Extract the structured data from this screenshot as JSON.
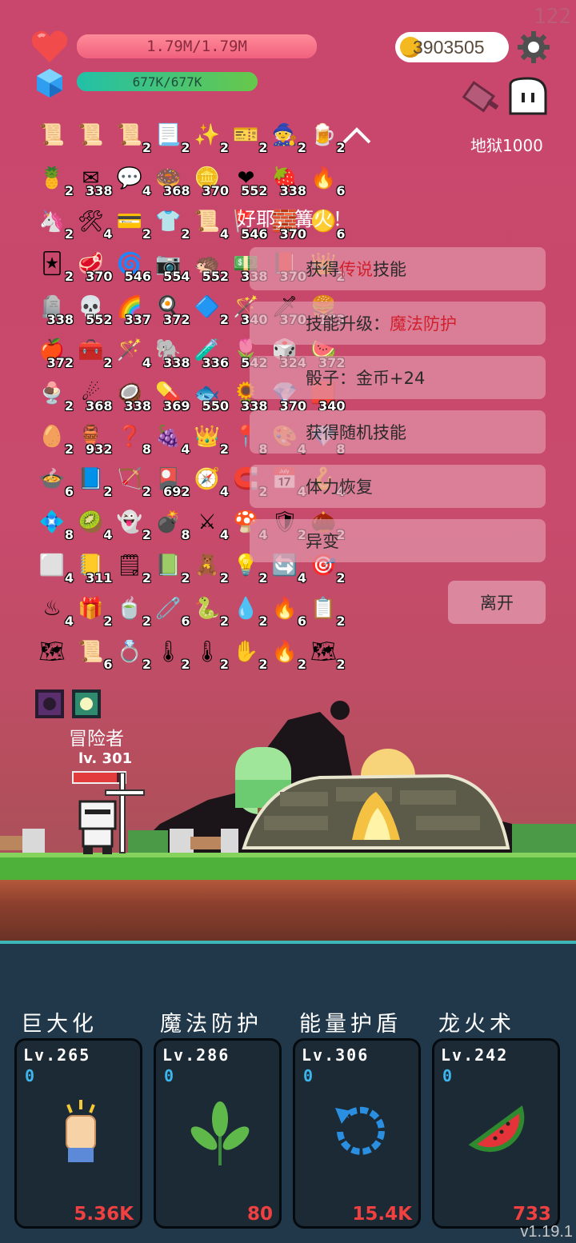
{
  "status": {
    "top_counter": "122",
    "hp_text": "1.79M/1.79M",
    "hp_fraction": 1.0,
    "mp_text": "677K/677K",
    "mp_fraction": 1.0,
    "gold": "3903505",
    "stage_label": "地狱1000"
  },
  "inventory": {
    "rows": [
      [
        {
          "i": "📜",
          "c": ""
        },
        {
          "i": "📜",
          "c": ""
        },
        {
          "i": "📜",
          "c": "2"
        },
        {
          "i": "📃",
          "c": "2"
        },
        {
          "i": "✨",
          "c": "2"
        },
        {
          "i": "🎫",
          "c": "2"
        },
        {
          "i": "🧙",
          "c": "2"
        },
        {
          "i": "🍺",
          "c": "2"
        }
      ],
      [
        {
          "i": "🍍",
          "c": "2"
        },
        {
          "i": "✉",
          "c": "338"
        },
        {
          "i": "💬",
          "c": "4"
        },
        {
          "i": "🍩",
          "c": "368"
        },
        {
          "i": "🪙",
          "c": "370"
        },
        {
          "i": "❤",
          "c": "552"
        },
        {
          "i": "🍓",
          "c": "338"
        },
        {
          "i": "🔥",
          "c": "6"
        }
      ],
      [
        {
          "i": "🦄",
          "c": "2"
        },
        {
          "i": "🛠",
          "c": "4"
        },
        {
          "i": "💳",
          "c": "2"
        },
        {
          "i": "👕",
          "c": "2"
        },
        {
          "i": "📜",
          "c": "4"
        },
        {
          "i": "🚩",
          "c": "546"
        },
        {
          "i": "🧱",
          "c": "370"
        },
        {
          "i": "🟡",
          "c": "6"
        }
      ],
      [
        {
          "i": "🃏",
          "c": "2"
        },
        {
          "i": "🥩",
          "c": "370"
        },
        {
          "i": "🌀",
          "c": "546"
        },
        {
          "i": "📷",
          "c": "554"
        },
        {
          "i": "🦔",
          "c": "552"
        },
        {
          "i": "💵",
          "c": "338"
        },
        {
          "i": "📕",
          "c": "370"
        },
        {
          "i": "👑",
          "c": "2"
        }
      ],
      [
        {
          "i": "🪦",
          "c": "338"
        },
        {
          "i": "💀",
          "c": "552"
        },
        {
          "i": "🌈",
          "c": "337"
        },
        {
          "i": "🍳",
          "c": "372"
        },
        {
          "i": "🔷",
          "c": "2"
        },
        {
          "i": "🪄",
          "c": "340"
        },
        {
          "i": "🗡",
          "c": "370"
        },
        {
          "i": "🍔",
          "c": "173"
        }
      ],
      [
        {
          "i": "🍎",
          "c": "372"
        },
        {
          "i": "🧰",
          "c": "2"
        },
        {
          "i": "🪄",
          "c": "4"
        },
        {
          "i": "🐘",
          "c": "338"
        },
        {
          "i": "🧪",
          "c": "336"
        },
        {
          "i": "🌷",
          "c": "542"
        },
        {
          "i": "🎲",
          "c": "324"
        },
        {
          "i": "🍉",
          "c": "372"
        }
      ],
      [
        {
          "i": "🍨",
          "c": "2"
        },
        {
          "i": "☄",
          "c": "368"
        },
        {
          "i": "🥥",
          "c": "338"
        },
        {
          "i": "💊",
          "c": "369"
        },
        {
          "i": "🐟",
          "c": "550"
        },
        {
          "i": "🌻",
          "c": "338"
        },
        {
          "i": "💎",
          "c": "370"
        },
        {
          "i": "🟥",
          "c": "340"
        }
      ],
      [
        {
          "i": "🥚",
          "c": "2"
        },
        {
          "i": "🏺",
          "c": "932"
        },
        {
          "i": "❓",
          "c": "8"
        },
        {
          "i": "🍇",
          "c": "4"
        },
        {
          "i": "👑",
          "c": "2"
        },
        {
          "i": "📍",
          "c": "8"
        },
        {
          "i": "🎨",
          "c": "4"
        },
        {
          "i": "💎",
          "c": "8"
        }
      ],
      [
        {
          "i": "🍲",
          "c": "6"
        },
        {
          "i": "📘",
          "c": "2"
        },
        {
          "i": "🏹",
          "c": "2"
        },
        {
          "i": "🎴",
          "c": "692"
        },
        {
          "i": "🧭",
          "c": "4"
        },
        {
          "i": "🧲",
          "c": "2"
        },
        {
          "i": "📅",
          "c": "4"
        },
        {
          "i": "🪝",
          "c": "4"
        }
      ],
      [
        {
          "i": "💠",
          "c": "8"
        },
        {
          "i": "🥝",
          "c": "4"
        },
        {
          "i": "👻",
          "c": "2"
        },
        {
          "i": "💣",
          "c": "8"
        },
        {
          "i": "⚔",
          "c": "4"
        },
        {
          "i": "🍄",
          "c": "4"
        },
        {
          "i": "🛡",
          "c": "2"
        },
        {
          "i": "🌰",
          "c": "2"
        }
      ],
      [
        {
          "i": "⬜",
          "c": "4"
        },
        {
          "i": "📒",
          "c": "311"
        },
        {
          "i": "🗒",
          "c": "2"
        },
        {
          "i": "📗",
          "c": "2"
        },
        {
          "i": "🧸",
          "c": "2"
        },
        {
          "i": "💡",
          "c": "2"
        },
        {
          "i": "🔄",
          "c": "4"
        },
        {
          "i": "🎯",
          "c": "2"
        }
      ],
      [
        {
          "i": "♨",
          "c": "4"
        },
        {
          "i": "🎁",
          "c": "2"
        },
        {
          "i": "🍵",
          "c": "2"
        },
        {
          "i": "🧷",
          "c": "6"
        },
        {
          "i": "🐍",
          "c": "2"
        },
        {
          "i": "💧",
          "c": "2"
        },
        {
          "i": "🔥",
          "c": "6"
        },
        {
          "i": "📋",
          "c": "2"
        }
      ],
      [
        {
          "i": "🗺",
          "c": ""
        },
        {
          "i": "📜",
          "c": "6"
        },
        {
          "i": "💍",
          "c": "2"
        },
        {
          "i": "🌡",
          "c": "2"
        },
        {
          "i": "🌡",
          "c": "2"
        },
        {
          "i": "✋",
          "c": "2"
        },
        {
          "i": "🔥",
          "c": "2"
        },
        {
          "i": "🗺",
          "c": "2"
        }
      ]
    ]
  },
  "event": {
    "title": "好耶，篝火！",
    "options": [
      {
        "prefix": "获得",
        "highlight": "传说",
        "suffix": "技能"
      },
      {
        "prefix": "技能升级：",
        "highlight": "魔法防护",
        "suffix": ""
      },
      {
        "prefix": "骰子：金币+24",
        "highlight": "",
        "suffix": ""
      },
      {
        "prefix": "获得随机技能",
        "highlight": "",
        "suffix": ""
      },
      {
        "prefix": "体力恢复",
        "highlight": "",
        "suffix": ""
      },
      {
        "prefix": "异变",
        "highlight": "",
        "suffix": ""
      }
    ],
    "leave": "离开"
  },
  "player": {
    "name": "冒险者",
    "level": "lv. 301",
    "hp_fraction": 0.85
  },
  "skills": [
    {
      "name": "巨大化",
      "level": "Lv.265",
      "cooldown": "0",
      "power": "5.36K",
      "icon": "fist-icon"
    },
    {
      "name": "魔法防护",
      "level": "Lv.286",
      "cooldown": "0",
      "power": "80",
      "icon": "leaf-icon"
    },
    {
      "name": "能量护盾",
      "level": "Lv.306",
      "cooldown": "0",
      "power": "15.4K",
      "icon": "refresh-icon"
    },
    {
      "name": "龙火术",
      "level": "Lv.242",
      "cooldown": "0",
      "power": "733",
      "icon": "watermelon-icon"
    }
  ],
  "version": "v1.19.1"
}
